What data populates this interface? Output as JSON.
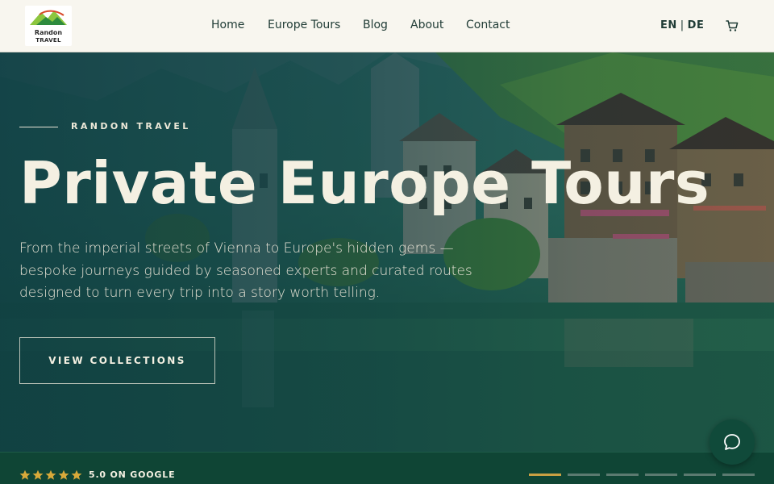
{
  "brand": {
    "logo_line1": "Randon",
    "logo_line2": "TRAVEL"
  },
  "nav": {
    "items": [
      {
        "label": "Home"
      },
      {
        "label": "Europe Tours"
      },
      {
        "label": "Blog"
      },
      {
        "label": "About"
      },
      {
        "label": "Contact"
      }
    ]
  },
  "lang": {
    "en": "EN",
    "separator": "|",
    "de": "DE"
  },
  "icons": {
    "cart": "cart-icon",
    "chat": "chat-bubble-icon",
    "star": "star-icon"
  },
  "hero": {
    "eyebrow": "RANDON TRAVEL",
    "title": "Private Europe Tours",
    "subtitle": "From the imperial streets of Vienna to Europe's hidden gems — bespoke journeys guided by seasoned experts and curated routes designed to turn every trip into a story worth telling.",
    "cta_label": "VIEW COLLECTIONS"
  },
  "rating": {
    "stars": 5,
    "text": "5.0 ON GOOGLE"
  },
  "slider": {
    "count": 6,
    "active_index": 0
  },
  "colors": {
    "header_bg": "#f8f6ef",
    "accent_gold": "#c9a043",
    "dark_green": "#0f4535",
    "text_cream": "#f4f0e2"
  }
}
